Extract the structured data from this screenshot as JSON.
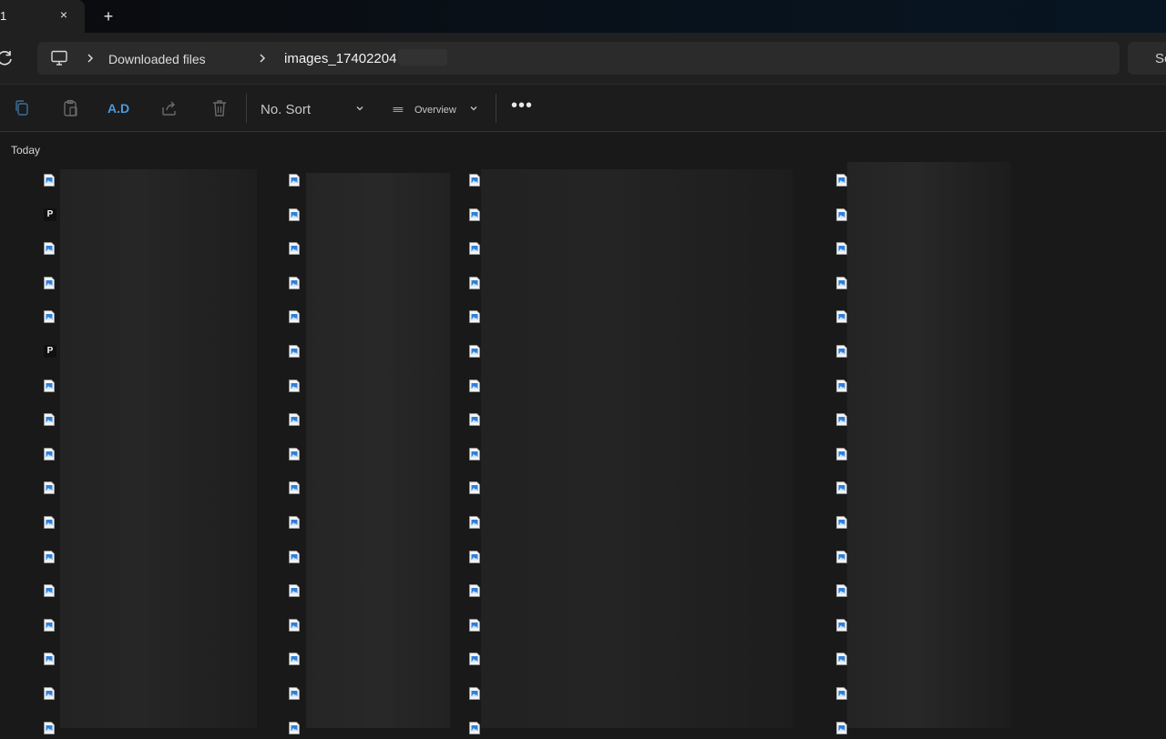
{
  "tab": {
    "title": "1",
    "close_glyph": "×",
    "new_tab_glyph": "+"
  },
  "address": {
    "root_icon": "computer-icon",
    "crumbs": [
      "Downloaded files",
      "images_17402204"
    ]
  },
  "search": {
    "placeholder": "Se"
  },
  "toolbar": {
    "rename_label": "A.D",
    "sort_label": "No. Sort",
    "view_label": "Overview",
    "view_glyph": "≡≡",
    "more_glyph": "•••",
    "accent_color": "#4c9ae0"
  },
  "content": {
    "group_header": "Today",
    "columns": [
      {
        "icons": [
          "image-file-icon",
          "p-file-icon",
          "image-file-icon",
          "image-file-icon",
          "image-file-icon",
          "p-file-icon",
          "image-file-icon",
          "image-file-icon",
          "image-file-icon",
          "image-file-icon",
          "image-file-icon",
          "image-file-icon",
          "image-file-icon",
          "image-file-icon",
          "image-file-icon",
          "image-file-icon",
          "image-file-icon"
        ]
      },
      {
        "icons": [
          "image-file-icon",
          "image-file-icon",
          "image-file-icon",
          "image-file-icon",
          "image-file-icon",
          "image-file-icon",
          "image-file-icon",
          "image-file-icon",
          "image-file-icon",
          "image-file-icon",
          "image-file-icon",
          "image-file-icon",
          "image-file-icon",
          "image-file-icon",
          "image-file-icon",
          "image-file-icon",
          "image-file-icon"
        ]
      },
      {
        "icons": [
          "image-file-icon",
          "image-file-icon",
          "image-file-icon",
          "image-file-icon",
          "image-file-icon",
          "image-file-icon",
          "image-file-icon",
          "image-file-icon",
          "image-file-icon",
          "image-file-icon",
          "image-file-icon",
          "image-file-icon",
          "image-file-icon",
          "image-file-icon",
          "image-file-icon",
          "image-file-icon",
          "image-file-icon"
        ]
      },
      {
        "icons": [
          "image-file-icon",
          "image-file-icon",
          "image-file-icon",
          "image-file-icon",
          "image-file-icon",
          "image-file-icon",
          "image-file-icon",
          "image-file-icon",
          "image-file-icon",
          "image-file-icon",
          "image-file-icon",
          "image-file-icon",
          "image-file-icon",
          "image-file-icon",
          "image-file-icon",
          "image-file-icon",
          "image-file-icon"
        ]
      }
    ],
    "p_label": "P"
  }
}
